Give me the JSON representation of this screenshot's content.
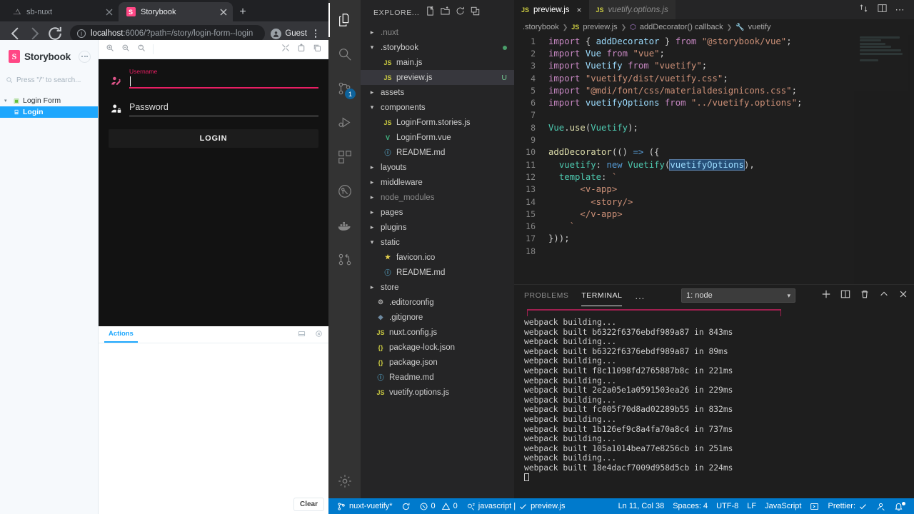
{
  "browser": {
    "tabs": [
      {
        "title": "sb-nuxt",
        "icon": "nuxt-icon",
        "active": false
      },
      {
        "title": "Storybook",
        "icon": "storybook-icon",
        "active": true
      }
    ],
    "new_tab_label": "+",
    "address": {
      "host": "localhost",
      "rest": ":6006/?path=/story/login-form--login"
    },
    "profile_label": "Guest"
  },
  "storybook": {
    "brand": {
      "mark": "S",
      "title": "Storybook"
    },
    "search_placeholder": "Press \"/\" to search...",
    "tree": [
      {
        "label": "Login Form",
        "selected": false
      },
      {
        "label": "Login",
        "selected": true
      }
    ],
    "preview": {
      "username_label": "Username",
      "username_value": "",
      "password_label": "Password",
      "password_value": "",
      "login_button": "LOGIN"
    },
    "addon": {
      "tab": "Actions",
      "clear_button": "Clear"
    }
  },
  "vscode": {
    "activity_bar": [
      {
        "name": "explorer-icon",
        "badge": ""
      },
      {
        "name": "search-icon",
        "badge": ""
      },
      {
        "name": "source-control-icon",
        "badge": "1"
      },
      {
        "name": "run-debug-icon",
        "badge": ""
      },
      {
        "name": "extensions-icon",
        "badge": ""
      },
      {
        "name": "gitlens-icon",
        "badge": ""
      },
      {
        "name": "docker-icon",
        "badge": ""
      },
      {
        "name": "pull-request-icon",
        "badge": ""
      },
      {
        "name": "settings-gear-icon",
        "badge": ""
      }
    ],
    "sidebar": {
      "title": "EXPLORE...",
      "files": [
        {
          "label": ".nuxt",
          "kind": "folder",
          "depth": 0,
          "expanded": false,
          "icon": "chevron-right",
          "dim": true
        },
        {
          "label": ".storybook",
          "kind": "folder",
          "depth": 0,
          "expanded": true,
          "icon": "chevron-down",
          "dot": true
        },
        {
          "label": "main.js",
          "kind": "js",
          "depth": 1
        },
        {
          "label": "preview.js",
          "kind": "js",
          "depth": 1,
          "selected": true,
          "suffix": "U"
        },
        {
          "label": "assets",
          "kind": "folder",
          "depth": 0,
          "expanded": false,
          "icon": "chevron-right"
        },
        {
          "label": "components",
          "kind": "folder",
          "depth": 0,
          "expanded": true,
          "icon": "chevron-down"
        },
        {
          "label": "LoginForm.stories.js",
          "kind": "js",
          "depth": 1
        },
        {
          "label": "LoginForm.vue",
          "kind": "vue",
          "depth": 1
        },
        {
          "label": "README.md",
          "kind": "md",
          "depth": 1
        },
        {
          "label": "layouts",
          "kind": "folder",
          "depth": 0,
          "expanded": false,
          "icon": "chevron-right"
        },
        {
          "label": "middleware",
          "kind": "folder",
          "depth": 0,
          "expanded": false,
          "icon": "chevron-right"
        },
        {
          "label": "node_modules",
          "kind": "folder",
          "depth": 0,
          "expanded": false,
          "icon": "chevron-right",
          "dim": true
        },
        {
          "label": "pages",
          "kind": "folder",
          "depth": 0,
          "expanded": false,
          "icon": "chevron-right"
        },
        {
          "label": "plugins",
          "kind": "folder",
          "depth": 0,
          "expanded": false,
          "icon": "chevron-right"
        },
        {
          "label": "static",
          "kind": "folder",
          "depth": 0,
          "expanded": true,
          "icon": "chevron-down"
        },
        {
          "label": "favicon.ico",
          "kind": "star",
          "depth": 1
        },
        {
          "label": "README.md",
          "kind": "md",
          "depth": 1
        },
        {
          "label": "store",
          "kind": "folder",
          "depth": 0,
          "expanded": false,
          "icon": "chevron-right"
        },
        {
          "label": ".editorconfig",
          "kind": "gear",
          "depth": 0
        },
        {
          "label": ".gitignore",
          "kind": "git",
          "depth": 0
        },
        {
          "label": "nuxt.config.js",
          "kind": "js",
          "depth": 0
        },
        {
          "label": "package-lock.json",
          "kind": "json",
          "depth": 0
        },
        {
          "label": "package.json",
          "kind": "json",
          "depth": 0
        },
        {
          "label": "Readme.md",
          "kind": "md",
          "depth": 0
        },
        {
          "label": "vuetify.options.js",
          "kind": "js",
          "depth": 0
        }
      ]
    },
    "tabs": [
      {
        "label": "preview.js",
        "active": true,
        "italic": false,
        "closable": true
      },
      {
        "label": "vuetify.options.js",
        "active": false,
        "italic": true,
        "closable": false
      }
    ],
    "breadcrumb": [
      ".storybook",
      "preview.js",
      "addDecorator() callback",
      "vuetify"
    ],
    "code_lines": [
      {
        "n": 1,
        "text": "import { addDecorator } from \"@storybook/vue\";"
      },
      {
        "n": 2,
        "text": "import Vue from \"vue\";"
      },
      {
        "n": 3,
        "text": "import Vuetify from \"vuetify\";"
      },
      {
        "n": 4,
        "text": "import \"vuetify/dist/vuetify.css\";"
      },
      {
        "n": 5,
        "text": "import \"@mdi/font/css/materialdesignicons.css\";"
      },
      {
        "n": 6,
        "text": "import vuetifyOptions from \"../vuetify.options\";"
      },
      {
        "n": 7,
        "text": ""
      },
      {
        "n": 8,
        "text": "Vue.use(Vuetify);"
      },
      {
        "n": 9,
        "text": ""
      },
      {
        "n": 10,
        "text": "addDecorator(() => ({"
      },
      {
        "n": 11,
        "text": "  vuetify: new Vuetify(vuetifyOptions),"
      },
      {
        "n": 12,
        "text": "  template: `"
      },
      {
        "n": 13,
        "text": "      <v-app>"
      },
      {
        "n": 14,
        "text": "        <story/>"
      },
      {
        "n": 15,
        "text": "      </v-app>"
      },
      {
        "n": 16,
        "text": "    `"
      },
      {
        "n": 17,
        "text": "}));"
      },
      {
        "n": 18,
        "text": ""
      }
    ],
    "panel": {
      "tabs": [
        "PROBLEMS",
        "TERMINAL"
      ],
      "active_tab": "TERMINAL",
      "overflow": "...",
      "terminal_select": "1: node",
      "terminal_lines": [
        "webpack building...",
        "webpack built b6322f6376ebdf989a87 in 843ms",
        "webpack building...",
        "webpack built b6322f6376ebdf989a87 in 89ms",
        "webpack building...",
        "webpack built f8c11098fd2765887b8c in 221ms",
        "webpack building...",
        "webpack built 2e2a05e1a0591503ea26 in 229ms",
        "webpack building...",
        "webpack built fc005f70d8ad02289b55 in 832ms",
        "webpack building...",
        "webpack built 1b126ef9c8a4fa70a8c4 in 737ms",
        "webpack building...",
        "webpack built 105a1014bea77e8256cb in 251ms",
        "webpack building...",
        "webpack built 18e4dacf7009d958d5cb in 224ms"
      ]
    },
    "status_bar": {
      "branch": "nuxt-vuetify*",
      "errors": "0",
      "warnings": "0",
      "language_hint": "javascript | ",
      "checked_file": "preview.js",
      "position": "Ln 11, Col 38",
      "indent": "Spaces: 4",
      "encoding": "UTF-8",
      "eol": "LF",
      "language": "JavaScript",
      "prettier": "Prettier:"
    }
  }
}
